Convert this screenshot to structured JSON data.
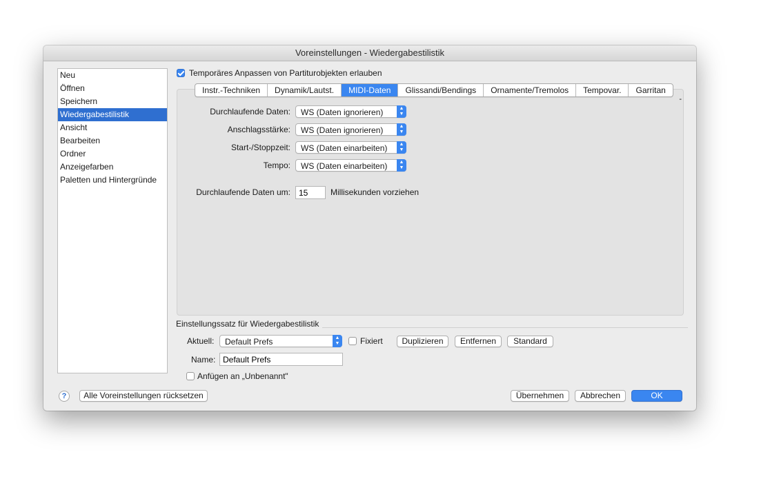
{
  "window": {
    "title": "Voreinstellungen - Wiedergabestilistik"
  },
  "sidebar": {
    "items": [
      {
        "label": "Neu"
      },
      {
        "label": "Öffnen"
      },
      {
        "label": "Speichern"
      },
      {
        "label": "Wiedergabestilistik",
        "selected": true
      },
      {
        "label": "Ansicht"
      },
      {
        "label": "Bearbeiten"
      },
      {
        "label": "Ordner"
      },
      {
        "label": "Anzeigefarben"
      },
      {
        "label": "Paletten und Hintergründe"
      }
    ]
  },
  "temp_adjust": {
    "label": "Temporäres Anpassen von Partiturobjekten erlauben",
    "checked": true
  },
  "tabs": [
    {
      "label": "Instr.-Techniken"
    },
    {
      "label": "Dynamik/Lautst."
    },
    {
      "label": "MIDI-Daten",
      "active": true
    },
    {
      "label": "Glissandi/Bendings"
    },
    {
      "label": "Ornamente/Tremolos"
    },
    {
      "label": "Tempovar."
    },
    {
      "label": "Garritan"
    }
  ],
  "panel_marker": "-",
  "midi_settings": [
    {
      "label": "Durchlaufende Daten:",
      "value": "WS (Daten ignorieren)"
    },
    {
      "label": "Anschlagsstärke:",
      "value": "WS (Daten ignorieren)"
    },
    {
      "label": "Start-/Stoppzeit:",
      "value": "WS (Daten einarbeiten)"
    },
    {
      "label": "Tempo:",
      "value": "WS (Daten einarbeiten)"
    }
  ],
  "advance": {
    "label": "Durchlaufende Daten um:",
    "value": "15",
    "unit": "Millisekunden vorziehen"
  },
  "preset_group": {
    "title": "Einstellungssatz für Wiedergabestilistik",
    "current_label": "Aktuell:",
    "current_value": "Default Prefs",
    "fixed_label": "Fixiert",
    "fixed_checked": false,
    "duplicate_label": "Duplizieren",
    "remove_label": "Entfernen",
    "standard_label": "Standard",
    "name_label": "Name:",
    "name_value": "Default Prefs",
    "append_label": "Anfügen an „Unbenannt\"",
    "append_checked": false
  },
  "footer": {
    "help_glyph": "?",
    "reset_label": "Alle Voreinstellungen rücksetzen",
    "apply_label": "Übernehmen",
    "cancel_label": "Abbrechen",
    "ok_label": "OK"
  },
  "colors": {
    "accent": "#3a86f0",
    "selection": "#2f6fd0",
    "window_bg": "#ececec",
    "panel_bg": "#e3e3e3"
  }
}
